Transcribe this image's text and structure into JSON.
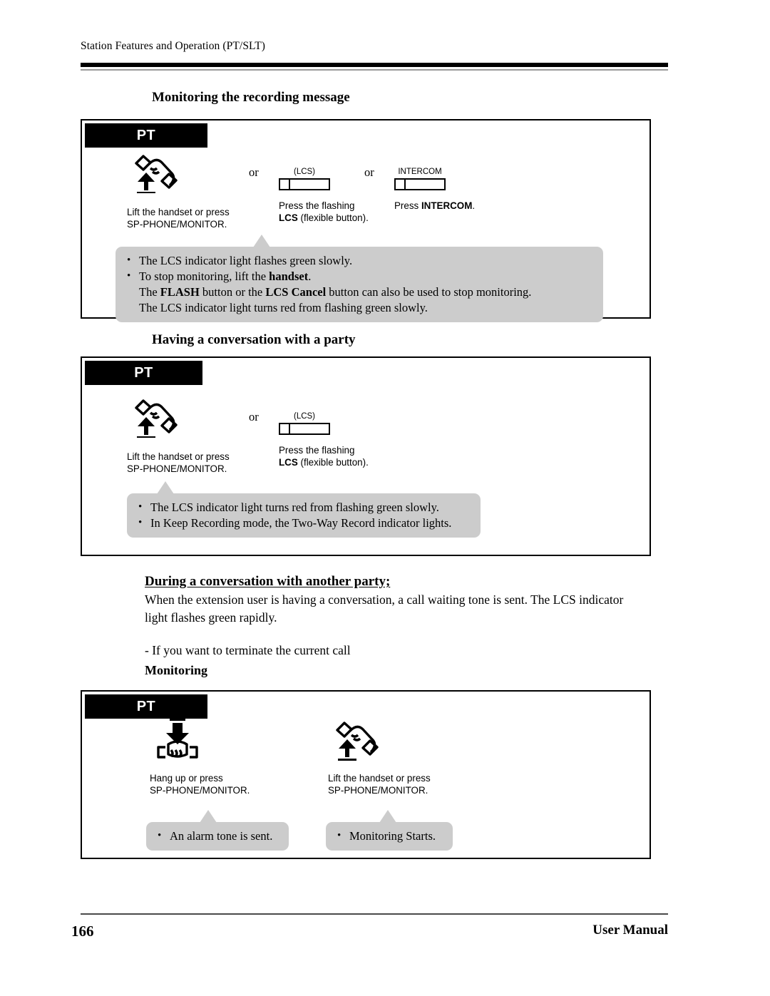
{
  "header": {
    "running_head": "Station Features and Operation (PT/SLT)"
  },
  "footer": {
    "page_number": "166",
    "manual_label": "User Manual"
  },
  "sections": [
    {
      "title": "Monitoring the recording message",
      "panel_tab": "PT",
      "steps": [
        {
          "icon": "lift-handset-icon",
          "caption_line1": "Lift the handset or press",
          "caption_line2": "SP-PHONE/MONITOR."
        },
        {
          "icon": "flexible-button-icon",
          "button_label": "(LCS)",
          "caption_line1": "Press the flashing",
          "caption_line2_bold": "LCS",
          "caption_line2_rest": " (flexible button)."
        },
        {
          "icon": "intercom-button-icon",
          "button_label": "INTERCOM",
          "caption_line1_rest": "Press ",
          "caption_line1_bold": "INTERCOM",
          "caption_line1_tail": "."
        }
      ],
      "connector_word": "or",
      "callout": {
        "lines": [
          {
            "bullet": true,
            "text": "The LCS indicator light flashes green slowly."
          },
          {
            "bullet": true,
            "pre": "To stop monitoring, lift the ",
            "bold": "handset",
            "post": "."
          },
          {
            "bullet": false,
            "pre": "The ",
            "bold": "FLASH",
            "mid": " button or the ",
            "bold2": "LCS Cancel",
            "post": " button can also be used to stop monitoring."
          },
          {
            "bullet": false,
            "text": "The LCS indicator light turns red from flashing green slowly."
          }
        ]
      }
    },
    {
      "title": "Having a conversation with a party",
      "panel_tab": "PT",
      "steps": [
        {
          "icon": "lift-handset-icon",
          "caption_line1": "Lift the handset or press",
          "caption_line2": "SP-PHONE/MONITOR."
        },
        {
          "icon": "flexible-button-icon",
          "button_label": "(LCS)",
          "caption_line1": "Press the flashing",
          "caption_line2_bold": "LCS",
          "caption_line2_rest": " (flexible button)."
        }
      ],
      "connector_word": "or",
      "callout": {
        "lines": [
          {
            "bullet": true,
            "text": "The LCS indicator light turns red from flashing green slowly."
          },
          {
            "bullet": true,
            "text": "In Keep Recording mode, the Two-Way Record indicator lights."
          }
        ]
      }
    },
    {
      "title": "During a conversation with another party;",
      "body_paragraph_line1": "When the extension user is having a conversation, a call waiting tone is sent. The LCS indicator",
      "body_paragraph_line2": "light flashes green rapidly.",
      "subnote": "- If you want to terminate the current call",
      "subtitle": "Monitoring",
      "panel_tab": "PT",
      "steps": [
        {
          "icon": "hang-up-icon",
          "caption_line1": "Hang up or press",
          "caption_line2": "SP-PHONE/MONITOR.",
          "callout_text": "An alarm tone is sent."
        },
        {
          "icon": "lift-handset-icon",
          "caption_line1": "Lift the handset or press",
          "caption_line2": "SP-PHONE/MONITOR.",
          "callout_text": "Monitoring Starts."
        }
      ]
    }
  ],
  "colors": {
    "callout_gray": "#cccccc",
    "tab_black": "#000000",
    "rule_gray": "#9a9a9a"
  }
}
